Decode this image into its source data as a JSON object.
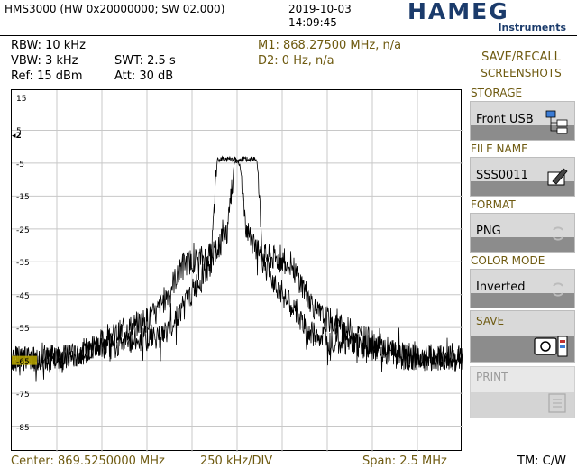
{
  "header": {
    "model": "HMS3000 (HW 0x20000000; SW 02.000)",
    "date": "2019-10-03",
    "time": "14:09:45",
    "logo_text": "HAMEG",
    "logo_sub": "Instruments",
    "logo_color": "#1b3b6b"
  },
  "settings": {
    "rbw": "RBW: 10 kHz",
    "vbw": "VBW: 3 kHz",
    "swt": "SWT: 2.5 s",
    "ref": "Ref: 15 dBm",
    "att": "Att: 30 dB",
    "m1": "M1: 868.27500 MHz, n/a",
    "d2": "D2: 0 Hz, n/a"
  },
  "plot": {
    "y_labels": [
      "15",
      "5",
      "-5",
      "-15",
      "-25",
      "-35",
      "-45",
      "-55",
      "-65",
      "-75",
      "-85"
    ],
    "ref_marker": "◂2"
  },
  "footer": {
    "center": "Center: 869.5250000 MHz",
    "div": "250 kHz/DIV",
    "span": "Span: 2.5 MHz",
    "tm": "TM: C/W"
  },
  "menu": {
    "title_line1": "SAVE/RECALL",
    "title_line2": "SCREENSHOTS",
    "storage_label": "STORAGE",
    "storage_value": "Front USB",
    "filename_label": "FILE NAME",
    "filename_value": "SSS0011",
    "format_label": "FORMAT",
    "format_value": "PNG",
    "colormode_label": "COLOR MODE",
    "colormode_value": "Inverted",
    "save_label": "SAVE",
    "print_label": "PRINT"
  },
  "colors": {
    "olive_text": "#6e5a10",
    "softkey_bg": "#d9d9d9",
    "softkey_band": "#8c8c8c",
    "noise_marker": "#c8b400"
  }
}
